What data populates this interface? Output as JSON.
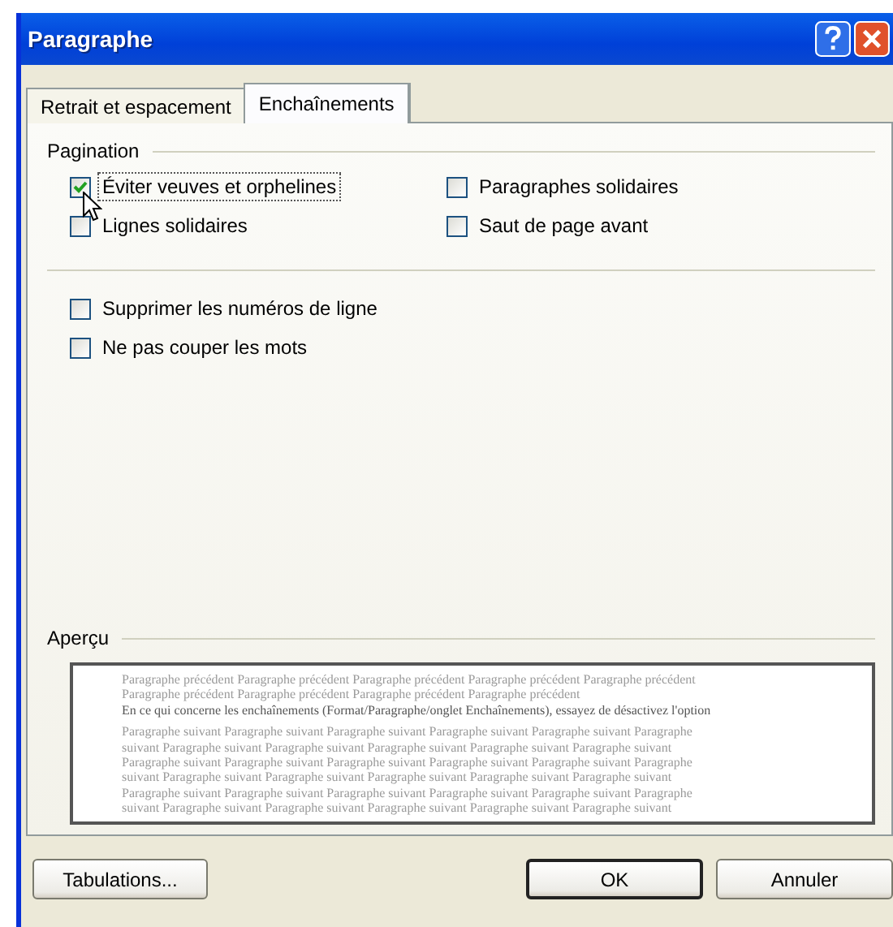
{
  "window": {
    "title": "Paragraphe"
  },
  "tabs": [
    {
      "label": "Retrait et espacement",
      "selected": false
    },
    {
      "label": "Enchaînements",
      "selected": true
    }
  ],
  "pagination": {
    "title": "Pagination",
    "options": [
      {
        "label": "Éviter veuves et orphelines",
        "checked": true,
        "focused": true
      },
      {
        "label": "Paragraphes solidaires",
        "checked": false,
        "focused": false
      },
      {
        "label": "Lignes solidaires",
        "checked": false,
        "focused": false
      },
      {
        "label": "Saut de page avant",
        "checked": false,
        "focused": false
      }
    ]
  },
  "other_options": [
    {
      "label": "Supprimer les numéros de ligne",
      "checked": false
    },
    {
      "label": "Ne pas couper les mots",
      "checked": false
    }
  ],
  "preview": {
    "title": "Aperçu",
    "lines": [
      {
        "kind": "faint",
        "text": "Paragraphe précédent Paragraphe précédent Paragraphe précédent Paragraphe précédent Paragraphe précédent"
      },
      {
        "kind": "faint",
        "text": "Paragraphe précédent Paragraphe précédent Paragraphe précédent Paragraphe précédent"
      },
      {
        "kind": "current",
        "text": "En ce qui concerne les enchaînements (Format/Paragraphe/onglet Enchaînements), essayez de désactivez l'option"
      },
      {
        "kind": "faint",
        "text": "Paragraphe suivant Paragraphe suivant Paragraphe suivant Paragraphe suivant Paragraphe suivant Paragraphe"
      },
      {
        "kind": "faint",
        "text": "suivant Paragraphe suivant Paragraphe suivant Paragraphe suivant Paragraphe suivant Paragraphe suivant"
      },
      {
        "kind": "faint",
        "text": "Paragraphe suivant Paragraphe suivant Paragraphe suivant Paragraphe suivant Paragraphe suivant Paragraphe"
      },
      {
        "kind": "faint",
        "text": "suivant Paragraphe suivant Paragraphe suivant Paragraphe suivant Paragraphe suivant Paragraphe suivant"
      },
      {
        "kind": "faint",
        "text": "Paragraphe suivant Paragraphe suivant Paragraphe suivant Paragraphe suivant Paragraphe suivant Paragraphe"
      },
      {
        "kind": "faint",
        "text": "suivant Paragraphe suivant Paragraphe suivant Paragraphe suivant Paragraphe suivant Paragraphe suivant"
      }
    ]
  },
  "buttons": [
    {
      "label": "Tabulations...",
      "kind": "secondary",
      "default": false
    },
    {
      "label": "OK",
      "kind": "primary",
      "default": true
    },
    {
      "label": "Annuler",
      "kind": "primary",
      "default": false
    }
  ]
}
